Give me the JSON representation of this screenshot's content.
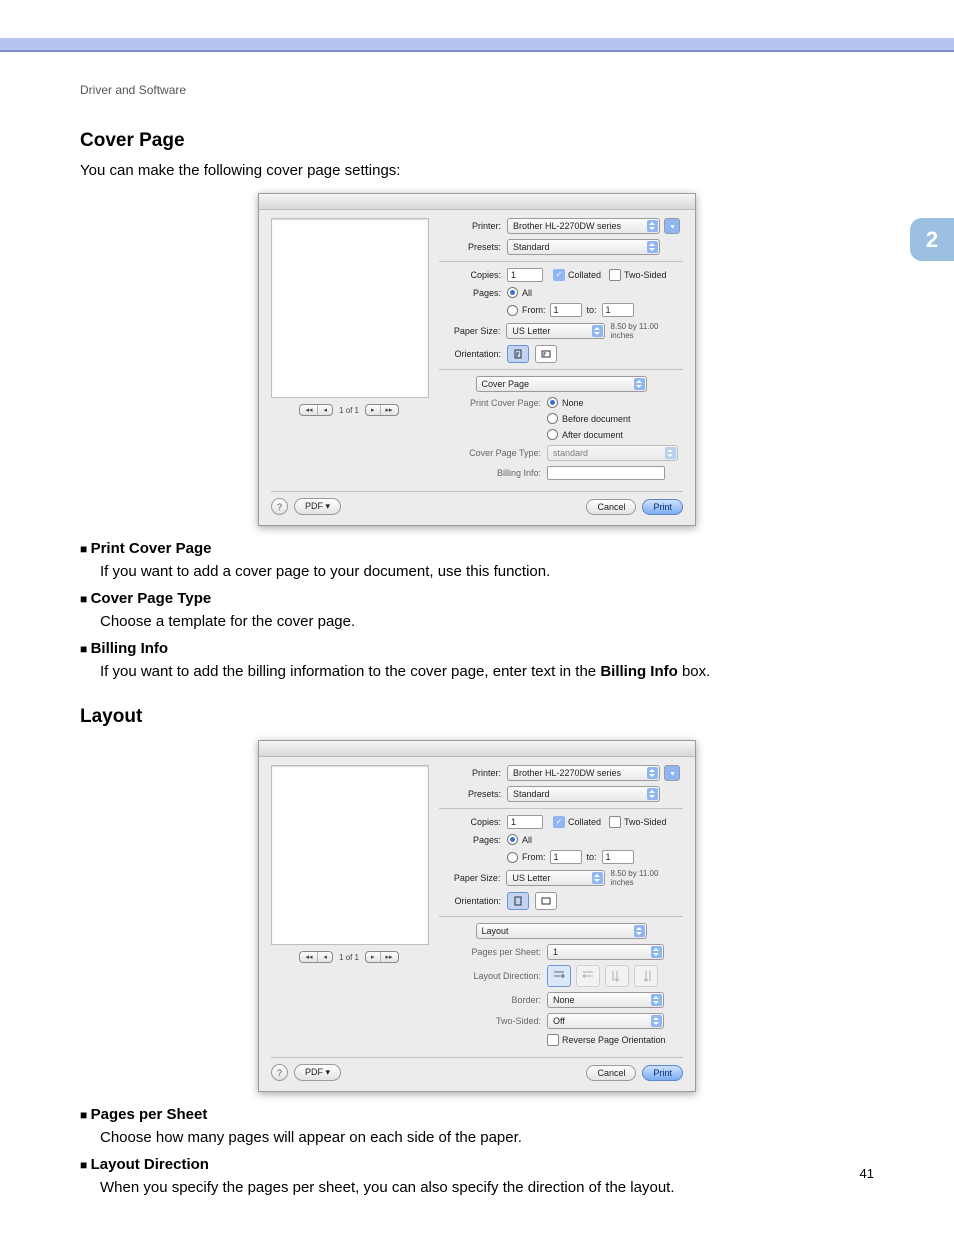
{
  "doc": {
    "breadcrumb": "Driver and Software",
    "chapter_tab": "2",
    "page_number": "41"
  },
  "section1": {
    "heading": "Cover Page",
    "intro": "You can make the following cover page settings:"
  },
  "section2": {
    "heading": "Layout"
  },
  "bullets1": [
    {
      "title": "Print Cover Page",
      "body_plain": "If you want to add a cover page to your document, use this function."
    },
    {
      "title": "Cover Page Type",
      "body_plain": "Choose a template for the cover page."
    },
    {
      "title": "Billing Info",
      "body_prefix": "If you want to add the billing information to the cover page, enter text in the ",
      "body_bold": "Billing Info",
      "body_suffix": " box."
    }
  ],
  "bullets2": [
    {
      "title": "Pages per Sheet",
      "body_plain": "Choose how many pages will appear on each side of the paper."
    },
    {
      "title": "Layout Direction",
      "body_plain": "When you specify the pages per sheet, you can also specify the direction of the layout."
    }
  ],
  "dialog_common": {
    "labels": {
      "printer": "Printer:",
      "presets": "Presets:",
      "copies": "Copies:",
      "pages": "Pages:",
      "from": "From:",
      "to": "to:",
      "paper_size": "Paper Size:",
      "orientation": "Orientation:"
    },
    "values": {
      "printer": "Brother HL-2270DW series",
      "presets": "Standard",
      "copies": "1",
      "collated": "Collated",
      "two_sided": "Two-Sided",
      "pages_all": "All",
      "from": "1",
      "to": "1",
      "paper_size": "US Letter",
      "paper_dim": "8.50 by 11.00 inches",
      "page_of": "1 of 1"
    },
    "buttons": {
      "pdf": "PDF ▾",
      "cancel": "Cancel",
      "print": "Print",
      "help": "?"
    }
  },
  "dialog_cover": {
    "pane_name": "Cover Page",
    "labels": {
      "print_cover_page": "Print Cover Page:",
      "cover_page_type": "Cover Page Type:",
      "billing_info": "Billing Info:"
    },
    "options": {
      "none": "None",
      "before": "Before document",
      "after": "After document"
    },
    "values": {
      "cover_page_type": "standard",
      "billing_info": ""
    }
  },
  "dialog_layout": {
    "pane_name": "Layout",
    "labels": {
      "pages_per_sheet": "Pages per Sheet:",
      "layout_direction": "Layout Direction:",
      "border": "Border:",
      "two_sided": "Two-Sided:",
      "reverse": "Reverse Page Orientation"
    },
    "values": {
      "pages_per_sheet": "1",
      "border": "None",
      "two_sided": "Off"
    }
  }
}
